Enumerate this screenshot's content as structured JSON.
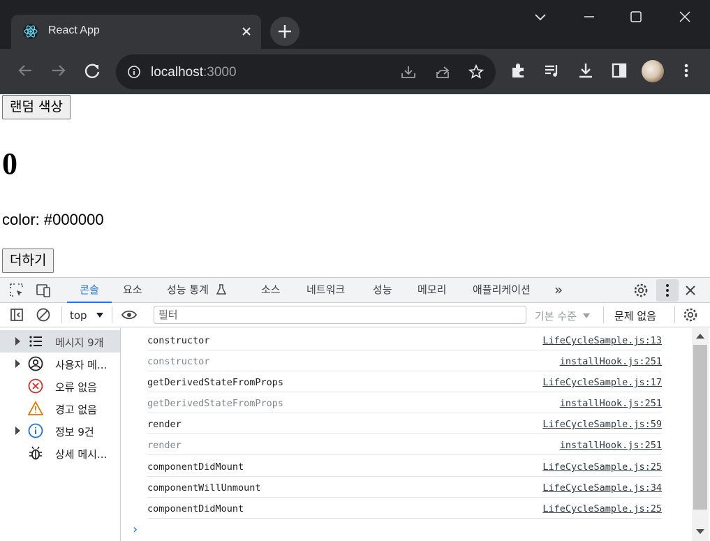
{
  "browser": {
    "tab_title": "React App",
    "url_host": "localhost",
    "url_port": ":3000"
  },
  "page": {
    "random_color_button": "랜덤 색상",
    "counter": "0",
    "color_text": "color: #000000",
    "add_button": "더하기"
  },
  "devtools": {
    "tabs": [
      "콘솔",
      "요소",
      "성능 통계",
      "소스",
      "네트워크",
      "성능",
      "메모리",
      "애플리케이션"
    ],
    "more_tabs": "»",
    "context": "top",
    "filter_placeholder": "필터",
    "level": "기본 수준",
    "issues": "문제 없음",
    "sidebar": [
      {
        "label": "메시지 9개",
        "icon": "list-icon",
        "expandable": true
      },
      {
        "label": "사용자 메...",
        "icon": "user-icon",
        "expandable": true
      },
      {
        "label": "오류 없음",
        "icon": "error-icon",
        "expandable": false
      },
      {
        "label": "경고 없음",
        "icon": "warning-icon",
        "expandable": false
      },
      {
        "label": "정보 9건",
        "icon": "info-icon",
        "expandable": true
      },
      {
        "label": "상세 메시...",
        "icon": "bug-icon",
        "expandable": false
      }
    ],
    "logs": [
      {
        "message": "constructor",
        "source": "LifeCycleSample.js:13",
        "dim": false
      },
      {
        "message": "constructor",
        "source": "installHook.js:251",
        "dim": true
      },
      {
        "message": "getDerivedStateFromProps",
        "source": "LifeCycleSample.js:17",
        "dim": false
      },
      {
        "message": "getDerivedStateFromProps",
        "source": "installHook.js:251",
        "dim": true
      },
      {
        "message": "render",
        "source": "LifeCycleSample.js:59",
        "dim": false
      },
      {
        "message": "render",
        "source": "installHook.js:251",
        "dim": true
      },
      {
        "message": "componentDidMount",
        "source": "LifeCycleSample.js:25",
        "dim": false
      },
      {
        "message": "componentWillUnmount",
        "source": "LifeCycleSample.js:34",
        "dim": false
      },
      {
        "message": "componentDidMount",
        "source": "LifeCycleSample.js:25",
        "dim": false
      }
    ],
    "prompt": "›"
  },
  "colors": {
    "chrome_dark": "#202124",
    "chrome_tab": "#35363a",
    "accent_blue": "#1a73e8",
    "error_red": "#d93025",
    "warning_orange": "#e37400"
  }
}
